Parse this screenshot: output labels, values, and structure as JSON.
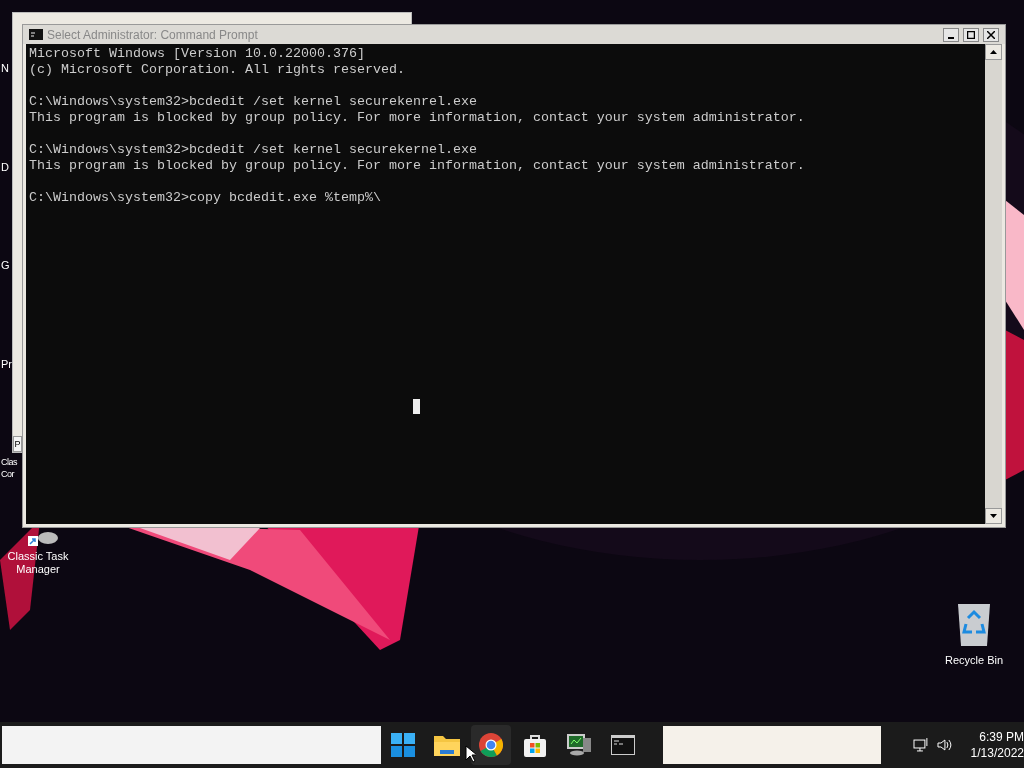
{
  "desktop_fragments": [
    "N",
    "D",
    "G",
    "Pr"
  ],
  "desktop_icons": [
    {
      "label": "Clas",
      "kind": "partial"
    },
    {
      "label": "Cor",
      "kind": "partial"
    },
    {
      "label": "Classic Task Manager",
      "kind": "shortcut"
    },
    {
      "label": "Recycle Bin",
      "kind": "recycle"
    }
  ],
  "background_window": {
    "button": "P"
  },
  "console": {
    "title": "Select Administrator: Command Prompt",
    "blocks": [
      [
        "Microsoft Windows [Version 10.0.22000.376]",
        "(c) Microsoft Corporation. All rights reserved."
      ],
      [
        "C:\\Windows\\system32>bcdedit /set kernel securekenrel.exe",
        "This program is blocked by group policy. For more information, contact your system administrator."
      ],
      [
        "C:\\Windows\\system32>bcdedit /set kernel securekernel.exe",
        "This program is blocked by group policy. For more information, contact your system administrator."
      ],
      [
        "C:\\Windows\\system32>copy bcdedit.exe %temp%\\"
      ]
    ]
  },
  "taskbar": {
    "apps": [
      {
        "kind": "start",
        "selected": false
      },
      {
        "kind": "folder",
        "selected": false
      },
      {
        "kind": "chrome",
        "selected": true
      },
      {
        "kind": "store",
        "selected": false
      },
      {
        "kind": "monitor",
        "selected": false
      },
      {
        "kind": "cmd",
        "selected": false
      }
    ],
    "time": "6:39 PM",
    "date": "1/13/2022"
  }
}
